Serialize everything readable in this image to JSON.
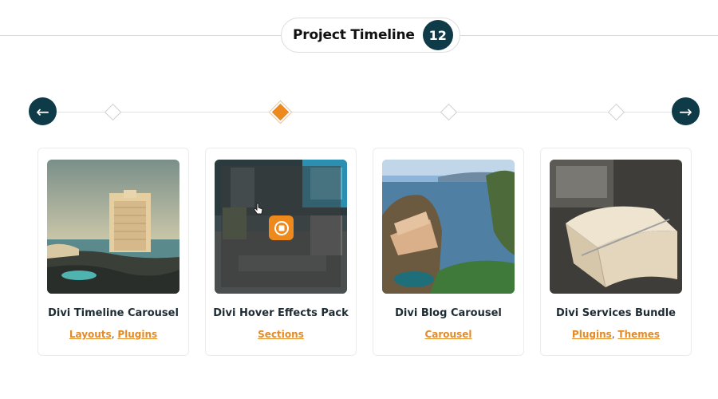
{
  "header": {
    "title": "Project Timeline",
    "count": "12"
  },
  "nav": {
    "prev_icon": "arrow-left-icon",
    "prev_glyph": "←",
    "next_icon": "arrow-right-icon",
    "next_glyph": "→"
  },
  "timeline": {
    "active_index": 1,
    "marker_count": 4
  },
  "cards": [
    {
      "title": "Divi Timeline Carousel",
      "tags": [
        "Layouts",
        "Plugins"
      ],
      "image": "hotel-coast-photo"
    },
    {
      "title": "Divi Hover Effects Pack",
      "tags": [
        "Sections"
      ],
      "image": "interior-hover-photo"
    },
    {
      "title": "Divi Blog Carousel",
      "tags": [
        "Carousel"
      ],
      "image": "cliff-village-photo"
    },
    {
      "title": "Divi Services Bundle",
      "tags": [
        "Plugins",
        "Themes"
      ],
      "image": "notebook-desk-photo"
    }
  ],
  "colors": {
    "accent": "#ee8a1d",
    "dark": "#0f3b48"
  },
  "separator": ", "
}
